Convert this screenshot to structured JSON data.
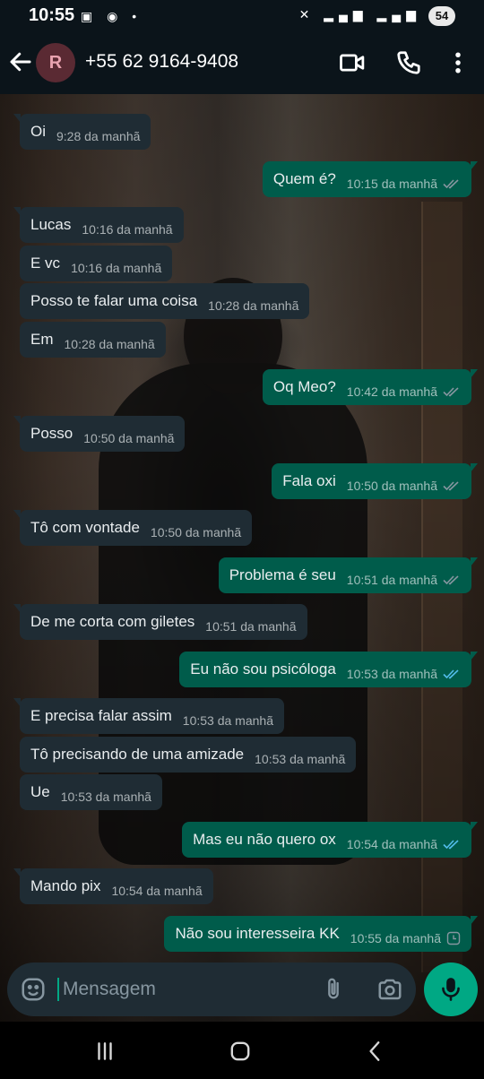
{
  "status_bar": {
    "time": "10:55",
    "battery": "54"
  },
  "header": {
    "avatar_letter": "R",
    "contact_name": "+55 62 9164-9408"
  },
  "messages": [
    {
      "dir": "in",
      "text": "Oi",
      "time": "9:28 da manhã"
    },
    {
      "dir": "out",
      "text": "Quem é?",
      "time": "10:15 da manhã",
      "status": "read-grey"
    },
    {
      "dir": "in",
      "text": "Lucas",
      "time": "10:16 da manhã"
    },
    {
      "dir": "in",
      "text": "E vc",
      "time": "10:16 da manhã"
    },
    {
      "dir": "in",
      "text": "Posso te falar uma coisa",
      "time": "10:28 da manhã"
    },
    {
      "dir": "in",
      "text": "Em",
      "time": "10:28 da manhã"
    },
    {
      "dir": "out",
      "text": "Oq Meo?",
      "time": "10:42 da manhã",
      "status": "read-grey"
    },
    {
      "dir": "in",
      "text": "Posso",
      "time": "10:50 da manhã"
    },
    {
      "dir": "out",
      "text": "Fala oxi",
      "time": "10:50 da manhã",
      "status": "read-grey"
    },
    {
      "dir": "in",
      "text": "Tô com vontade",
      "time": "10:50 da manhã"
    },
    {
      "dir": "out",
      "text": "Problema é seu",
      "time": "10:51 da manhã",
      "status": "read-grey"
    },
    {
      "dir": "in",
      "text": "De me corta com giletes",
      "time": "10:51 da manhã"
    },
    {
      "dir": "out",
      "text": "Eu não sou psicóloga",
      "time": "10:53 da manhã",
      "status": "read-blue"
    },
    {
      "dir": "in",
      "text": "E precisa falar assim",
      "time": "10:53 da manhã"
    },
    {
      "dir": "in",
      "text": "Tô precisando de uma amizade",
      "time": "10:53 da manhã"
    },
    {
      "dir": "in",
      "text": "Ue",
      "time": "10:53 da manhã"
    },
    {
      "dir": "out",
      "text": "Mas eu não quero ox",
      "time": "10:54 da manhã",
      "status": "read-blue"
    },
    {
      "dir": "in",
      "text": "Mando pix",
      "time": "10:54 da manhã"
    },
    {
      "dir": "out",
      "text": "Não sou interesseira KK",
      "time": "10:55 da manhã",
      "status": "pending"
    }
  ],
  "composer": {
    "placeholder": "Mensagem"
  },
  "colors": {
    "incoming_bubble": "#1f2c34",
    "outgoing_bubble": "#005c4b",
    "accent": "#00a884",
    "read_tick_blue": "#53bdeb",
    "background": "#0b141a"
  },
  "icons": {
    "header": [
      "back-arrow-icon",
      "video-call-icon",
      "phone-icon",
      "more-vert-icon"
    ],
    "composer": [
      "emoji-icon",
      "attach-clip-icon",
      "camera-icon",
      "mic-icon"
    ],
    "navbar": [
      "recent-apps-icon",
      "home-icon",
      "back-nav-icon"
    ]
  }
}
